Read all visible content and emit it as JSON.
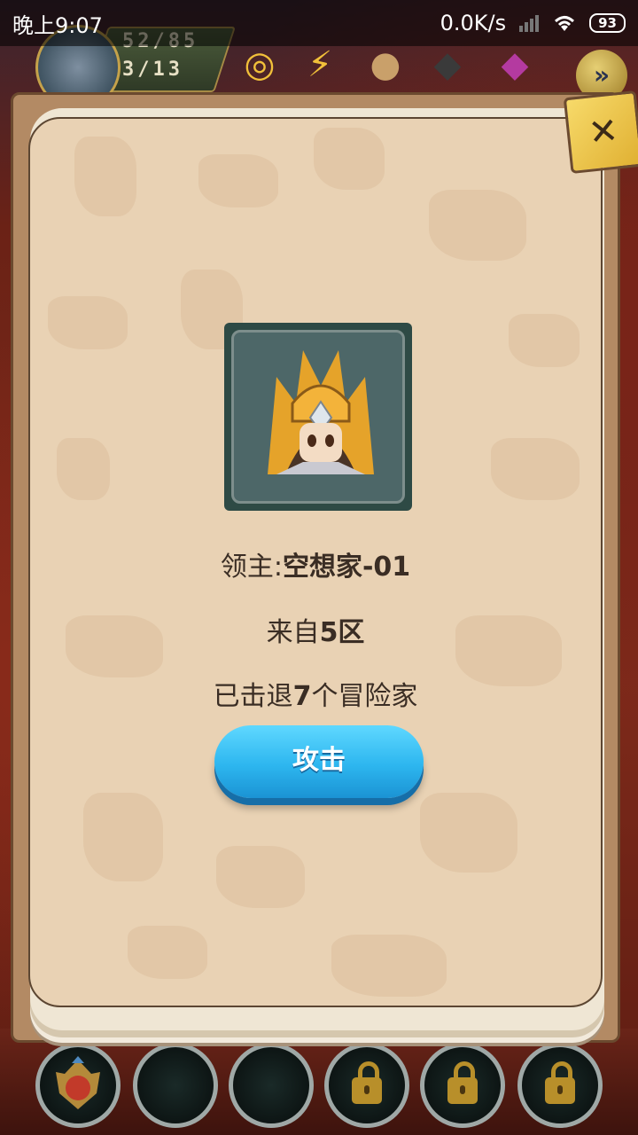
{
  "status_bar": {
    "time": "晚上9:07",
    "network_speed": "0.0K/s",
    "battery": "93"
  },
  "hud": {
    "stat_primary": "52/85",
    "stat_secondary": "3/13",
    "icons": [
      "coin-icon",
      "energy-icon",
      "bread-icon",
      "ore-icon",
      "crystal-icon"
    ],
    "fast_forward_icon": "fast-forward-icon"
  },
  "modal": {
    "lord_label": "领主:",
    "lord_name": "空想家-01",
    "from_prefix": "来自",
    "from_zone": "5区",
    "defeated_prefix": "已击退",
    "defeated_count": "7",
    "defeated_suffix": "个冒险家",
    "attack_label": "攻击",
    "close_icon": "close-icon"
  },
  "bottom_slots": [
    {
      "type": "hero",
      "icon": "hero-avatar-icon"
    },
    {
      "type": "empty"
    },
    {
      "type": "empty"
    },
    {
      "type": "locked",
      "icon": "lock-icon"
    },
    {
      "type": "locked",
      "icon": "lock-icon"
    },
    {
      "type": "locked",
      "icon": "lock-icon"
    }
  ],
  "colors": {
    "attack_button": "#2db6ef",
    "card_background": "#e9d2b4",
    "text": "#3a2d24"
  }
}
